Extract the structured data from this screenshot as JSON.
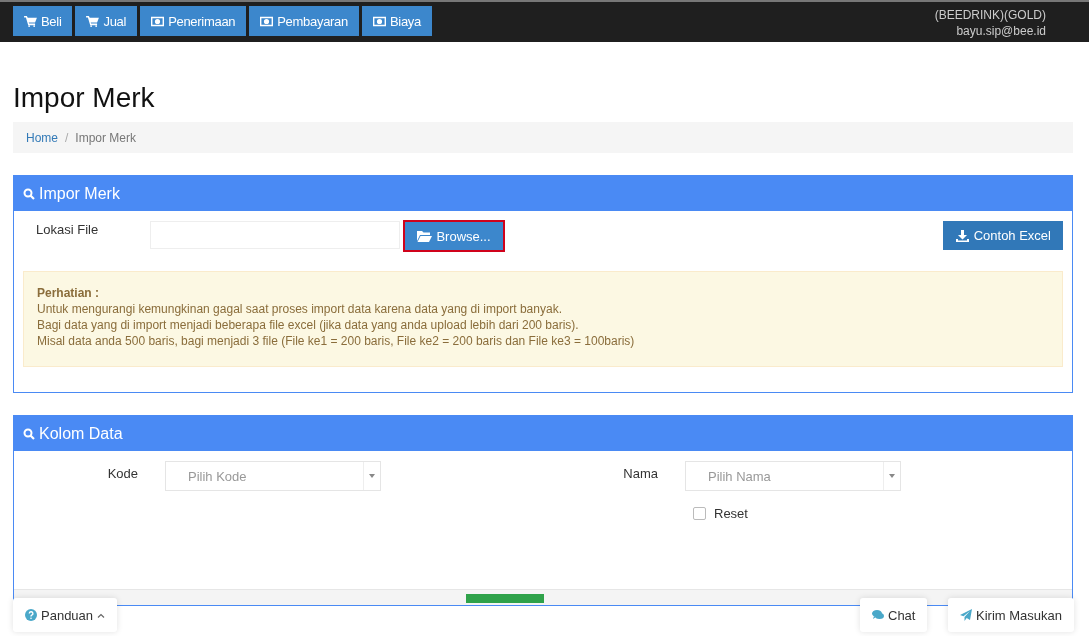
{
  "top_nav": {
    "items": [
      {
        "label": "Beli",
        "kind": "cart"
      },
      {
        "label": "Jual",
        "kind": "cart"
      },
      {
        "label": "Penerimaan",
        "kind": "money"
      },
      {
        "label": "Pembayaran",
        "kind": "money"
      },
      {
        "label": "Biaya",
        "kind": "money"
      }
    ],
    "account": "(BEEDRINK)(GOLD)",
    "email": "bayu.sip@bee.id"
  },
  "page_title": "Impor Merk",
  "breadcrumb_separator": "/",
  "breadcrumb": [
    {
      "label": "Home",
      "link": true
    },
    {
      "label": "Impor Merk",
      "link": false
    }
  ],
  "import_panel": {
    "title": "Impor Merk",
    "file_label": "Lokasi File",
    "browse_button": {
      "label": "Browse...",
      "highlighted": true
    },
    "sample_button": "Contoh Excel",
    "notice": {
      "heading": "Perhatian :",
      "lines": [
        "Untuk mengurangi kemungkinan gagal saat proses import data karena data yang di import banyak.",
        "Bagi data yang di import menjadi beberapa file excel (jika data yang anda upload lebih dari 200 baris).",
        "Misal data anda 500 baris, bagi menjadi 3 file (File ke1 = 200 baris, File ke2 = 200 baris dan File ke3 = 100baris)"
      ]
    }
  },
  "columns_panel": {
    "title": "Kolom Data",
    "fields": [
      {
        "label": "Kode",
        "placeholder": "Pilih Kode"
      },
      {
        "label": "Nama",
        "placeholder": "Pilih Nama"
      }
    ],
    "reset": {
      "label": "Reset",
      "checked": false
    }
  },
  "floating": {
    "help": "Panduan",
    "chat": "Chat",
    "feedback": "Kirim Masukan"
  }
}
